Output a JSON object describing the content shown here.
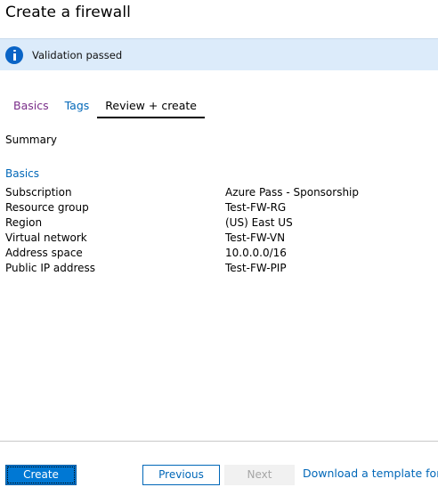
{
  "page": {
    "title": "Create a firewall"
  },
  "banner": {
    "icon": "info-icon",
    "text": "Validation passed"
  },
  "tabs": [
    {
      "label": "Basics"
    },
    {
      "label": "Tags"
    },
    {
      "label": "Review + create"
    }
  ],
  "summary": {
    "heading": "Summary",
    "section_title": "Basics",
    "rows": [
      {
        "label": "Subscription",
        "value": "Azure Pass - Sponsorship"
      },
      {
        "label": "Resource group",
        "value": "Test-FW-RG"
      },
      {
        "label": "Region",
        "value": "(US) East US"
      },
      {
        "label": "Virtual network",
        "value": "Test-FW-VN"
      },
      {
        "label": "Address space",
        "value": "10.0.0.0/16"
      },
      {
        "label": "Public IP address",
        "value": "Test-FW-PIP"
      }
    ]
  },
  "footer": {
    "create_label": "Create",
    "previous_label": "Previous",
    "next_label": "Next",
    "download_label": "Download a template for automation"
  },
  "colors": {
    "accent": "#0078d4",
    "link": "#0067b8",
    "banner_bg": "#dcebfa",
    "visited_tab": "#7a2e8a"
  }
}
